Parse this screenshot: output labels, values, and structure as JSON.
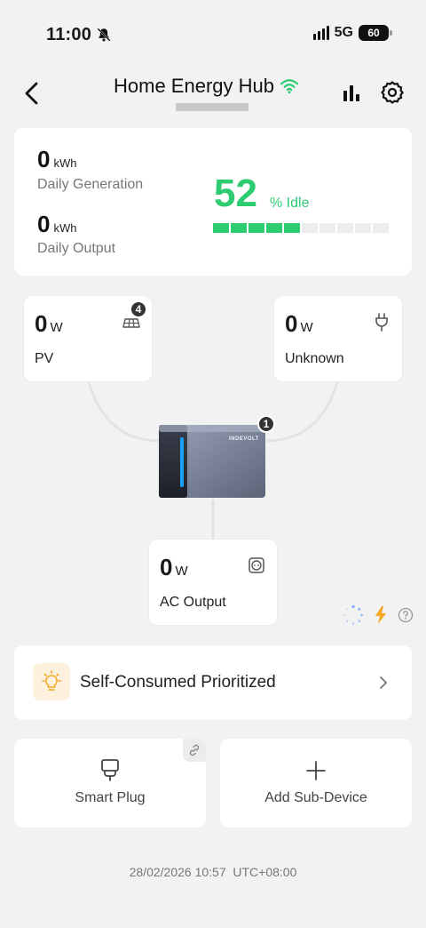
{
  "status_bar": {
    "time": "11:00",
    "network": "5G",
    "battery": "60",
    "icons": [
      "bell-muted-icon",
      "signal-icon",
      "battery-icon"
    ]
  },
  "header": {
    "title": "Home Energy Hub",
    "back_icon": "chevron-left-icon",
    "wifi_icon": "wifi-icon",
    "chart_icon": "bar-chart-icon",
    "settings_icon": "gear-icon"
  },
  "summary": {
    "generation_value": "0",
    "generation_unit": "kWh",
    "generation_label": "Daily Generation",
    "output_value": "0",
    "output_unit": "kWh",
    "output_label": "Daily Output",
    "soc_value": "52",
    "soc_label": "% Idle",
    "soc_percent": 52,
    "accent_color": "#2ecc71"
  },
  "flow": {
    "pv": {
      "value": "0",
      "unit": "W",
      "label": "PV",
      "badge": "4",
      "icon": "solar-panel-icon"
    },
    "unknown": {
      "value": "0",
      "unit": "W",
      "label": "Unknown",
      "icon": "plug-icon"
    },
    "device": {
      "brand": "INDEVOLT",
      "badge": "1"
    },
    "ac_output": {
      "value": "0",
      "unit": "W",
      "label": "AC Output",
      "icon": "socket-icon"
    }
  },
  "status_indicators": [
    "loading-icon",
    "lightning-icon",
    "help-icon"
  ],
  "mode": {
    "label": "Self-Consumed Prioritized",
    "icon": "lightbulb-icon"
  },
  "tiles": {
    "smart_plug_label": "Smart Plug",
    "add_sub_device_label": "Add Sub-Device"
  },
  "footer": {
    "timestamp": "28/02/2026 10:57  UTC+08:00"
  }
}
